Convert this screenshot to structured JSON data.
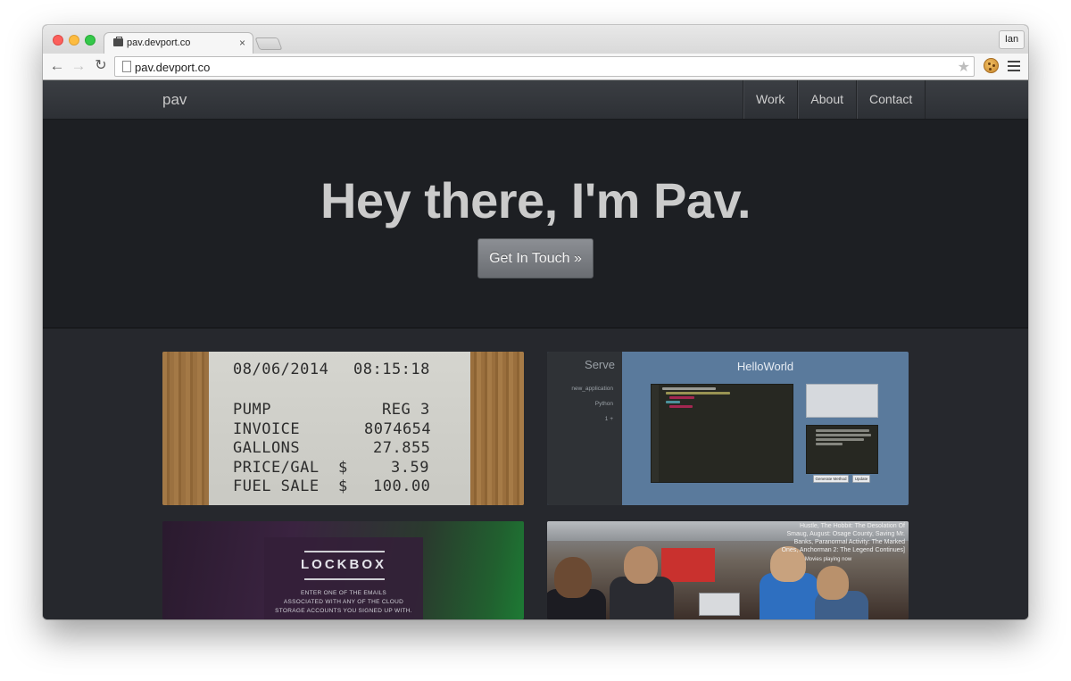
{
  "browser": {
    "tab_title": "pav.devport.co",
    "tab_close": "×",
    "profile_name": "Ian",
    "url": "pav.devport.co",
    "back_glyph": "←",
    "forward_glyph": "→",
    "reload_glyph": "↻",
    "star_glyph": "★"
  },
  "site": {
    "brand": "pav",
    "nav": [
      "Work",
      "About",
      "Contact"
    ],
    "hero_title": "Hey there, I'm Pav.",
    "cta_label": "Get In Touch »"
  },
  "tiles": {
    "receipt": {
      "date": "08/06/2014",
      "time": "08:15:18",
      "rows": [
        {
          "label": "PUMP",
          "value": "REG 3"
        },
        {
          "label": "INVOICE",
          "value": "8074654"
        },
        {
          "label": "GALLONS",
          "value": "27.855"
        },
        {
          "label": "PRICE/GAL",
          "currency": "$",
          "value": "3.59"
        },
        {
          "label": "FUEL SALE",
          "currency": "$",
          "value": "100.00"
        }
      ]
    },
    "editor": {
      "side_title": "Serve",
      "side_items": [
        "new_application",
        "Python",
        "1 +"
      ],
      "title": "HelloWorld",
      "buttons": [
        "Generate Method",
        "Update"
      ]
    },
    "lockbox": {
      "title": "LOCKBOX",
      "line1": "ENTER ONE OF THE EMAILS",
      "line2": "ASSOCIATED WITH ANY OF THE CLOUD",
      "line3": "STORAGE ACCOUNTS YOU SIGNED UP WITH."
    },
    "photo": {
      "caption1": "Hustle, The Hobbit: The Desolation Of",
      "caption2": "Smaug, August: Osage County, Saving Mr.",
      "caption3": "Banks, Paranormal Activity: The Marked",
      "caption4": "Ones, Anchorman 2: The Legend Continues]",
      "caption5": "Movies playing now"
    }
  }
}
